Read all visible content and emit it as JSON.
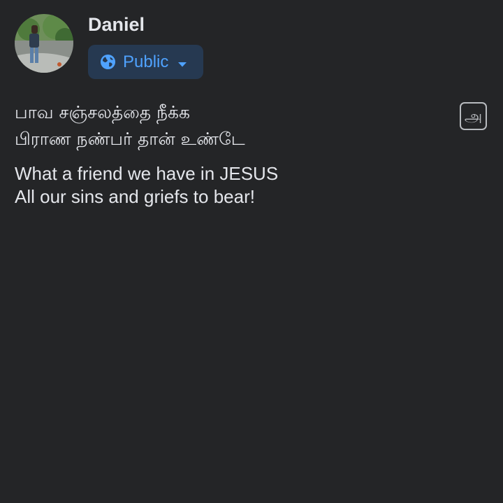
{
  "post": {
    "author": {
      "name": "Daniel",
      "avatar_icon": "profile-photo-person-outdoors"
    },
    "privacy": {
      "label": "Public",
      "icon": "globe-icon",
      "dropdown_icon": "caret-down-icon"
    },
    "translate": {
      "glyph": "அ",
      "icon": "translate-icon"
    },
    "text": {
      "tamil_lines": [
        "பாவ சஞ்சலத்தை நீக்க",
        "பிராண நண்பர் தான் உண்டே"
      ],
      "english_lines": [
        "What a friend we have in JESUS",
        "All our sins and griefs to bear!"
      ]
    }
  },
  "colors": {
    "background": "#242527",
    "text": "#e4e6eb",
    "privacy_bg": "#263951",
    "accent_blue": "#4fa2ff",
    "icon_gray": "#b8bbbf"
  }
}
